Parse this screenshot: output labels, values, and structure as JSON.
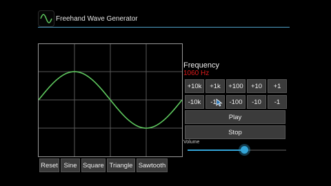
{
  "app": {
    "title": "Freehand Wave Generator",
    "icon": "sine-wave-icon"
  },
  "frequency": {
    "label": "Frequency",
    "value": "1060 Hz",
    "value_color": "#e01b1b"
  },
  "step_buttons": {
    "increase": [
      "+10k",
      "+1k",
      "+100",
      "+10",
      "+1"
    ],
    "decrease": [
      "-10k",
      "-1k",
      "-100",
      "-10",
      "-1"
    ]
  },
  "play_label": "Play",
  "stop_label": "Stop",
  "volume": {
    "label": "Volume",
    "level": 0.57
  },
  "wave_buttons": [
    "Reset",
    "Sine",
    "Square",
    "Triangle",
    "Sawtooth"
  ],
  "colors": {
    "wave": "#5fc95f",
    "accent": "#33a5d8"
  }
}
